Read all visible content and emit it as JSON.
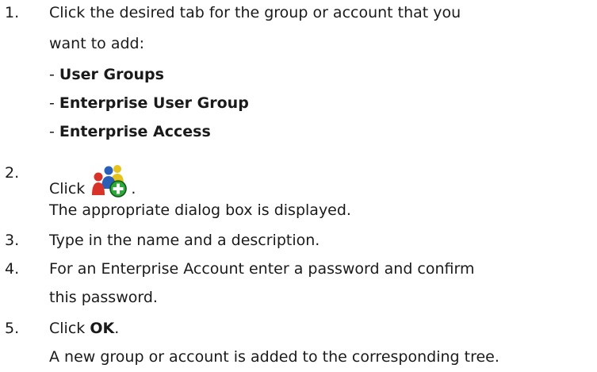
{
  "steps": [
    {
      "number": "1.",
      "lines": [
        "Click the desired tab for the group or account that you",
        "want to add:"
      ],
      "options": [
        {
          "prefix": "- ",
          "label": "User Groups"
        },
        {
          "prefix": "- ",
          "label": "Enterprise User Group"
        },
        {
          "prefix": "- ",
          "label": "Enterprise Access"
        }
      ]
    },
    {
      "number": "2.",
      "text_before": "Click ",
      "icon": "add-user-group-icon",
      "text_after": ".",
      "result": "The appropriate dialog box is displayed."
    },
    {
      "number": "3.",
      "text": "Type in the name and a description."
    },
    {
      "number": "4.",
      "lines": [
        "For an Enterprise Account enter a password and confirm",
        "this password."
      ]
    },
    {
      "number": "5.",
      "text_before": "Click ",
      "bold": "OK",
      "text_after": ".",
      "result": "A new group or account is added to the corresponding tree."
    }
  ],
  "colors": {
    "text": "#1a1a1a",
    "icon_red": "#d8332a",
    "icon_blue": "#2a5fb8",
    "icon_yellow": "#e5c21c",
    "icon_green": "#2ea83a"
  }
}
